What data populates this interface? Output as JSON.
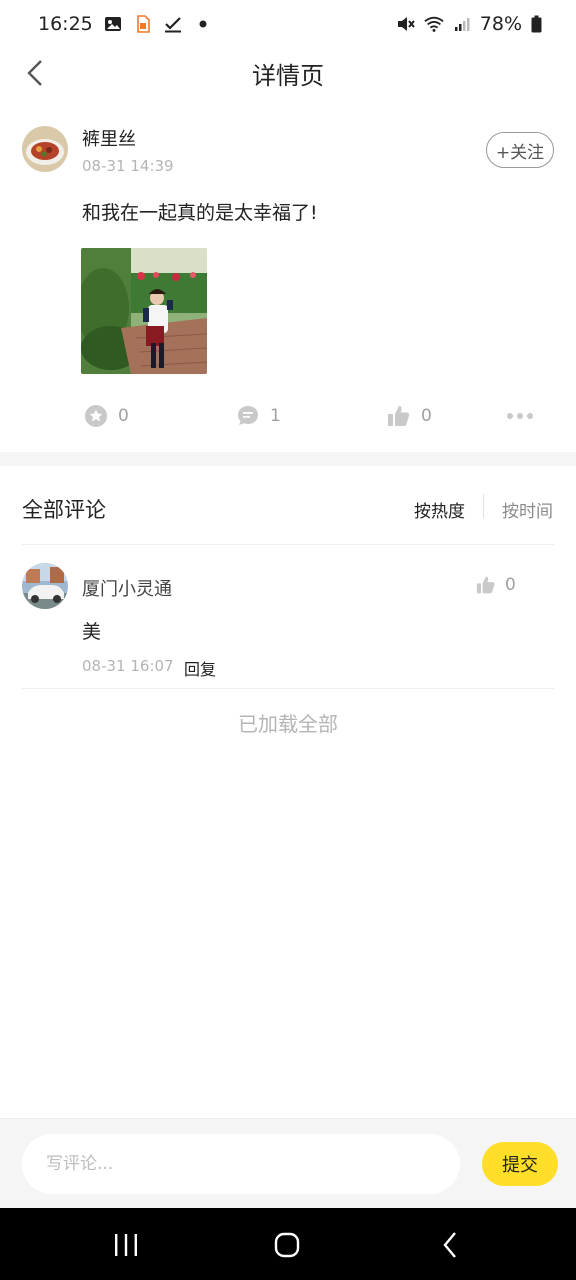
{
  "status_bar": {
    "time": "16:25",
    "battery": "78%",
    "icons": [
      "gallery-icon",
      "app-notification-icon",
      "check-icon",
      "dot-icon",
      "mute-icon",
      "wifi-icon",
      "signal-icon",
      "battery-icon"
    ]
  },
  "header": {
    "title": "详情页",
    "back_icon": "chevron-left-icon"
  },
  "post": {
    "author": "裤里丝",
    "time": "08-31 14:39",
    "follow_label": "+关注",
    "text": "和我在一起真的是太幸福了!",
    "image_icon": "post-photo",
    "actions": {
      "favorite_count": "0",
      "comment_count": "1",
      "like_count": "0"
    }
  },
  "comments": {
    "title": "全部评论",
    "sort_hot": "按热度",
    "sort_time": "按时间",
    "items": [
      {
        "author": "厦门小灵通",
        "text": "美",
        "time": "08-31 16:07",
        "reply_label": "回复",
        "like_count": "0"
      }
    ],
    "loaded_all": "已加载全部"
  },
  "input_bar": {
    "placeholder": "写评论...",
    "submit_label": "提交"
  },
  "colors": {
    "accent": "#ffde2a",
    "muted_text": "#b5b5b5",
    "icon_gray": "#c4c4c4"
  }
}
